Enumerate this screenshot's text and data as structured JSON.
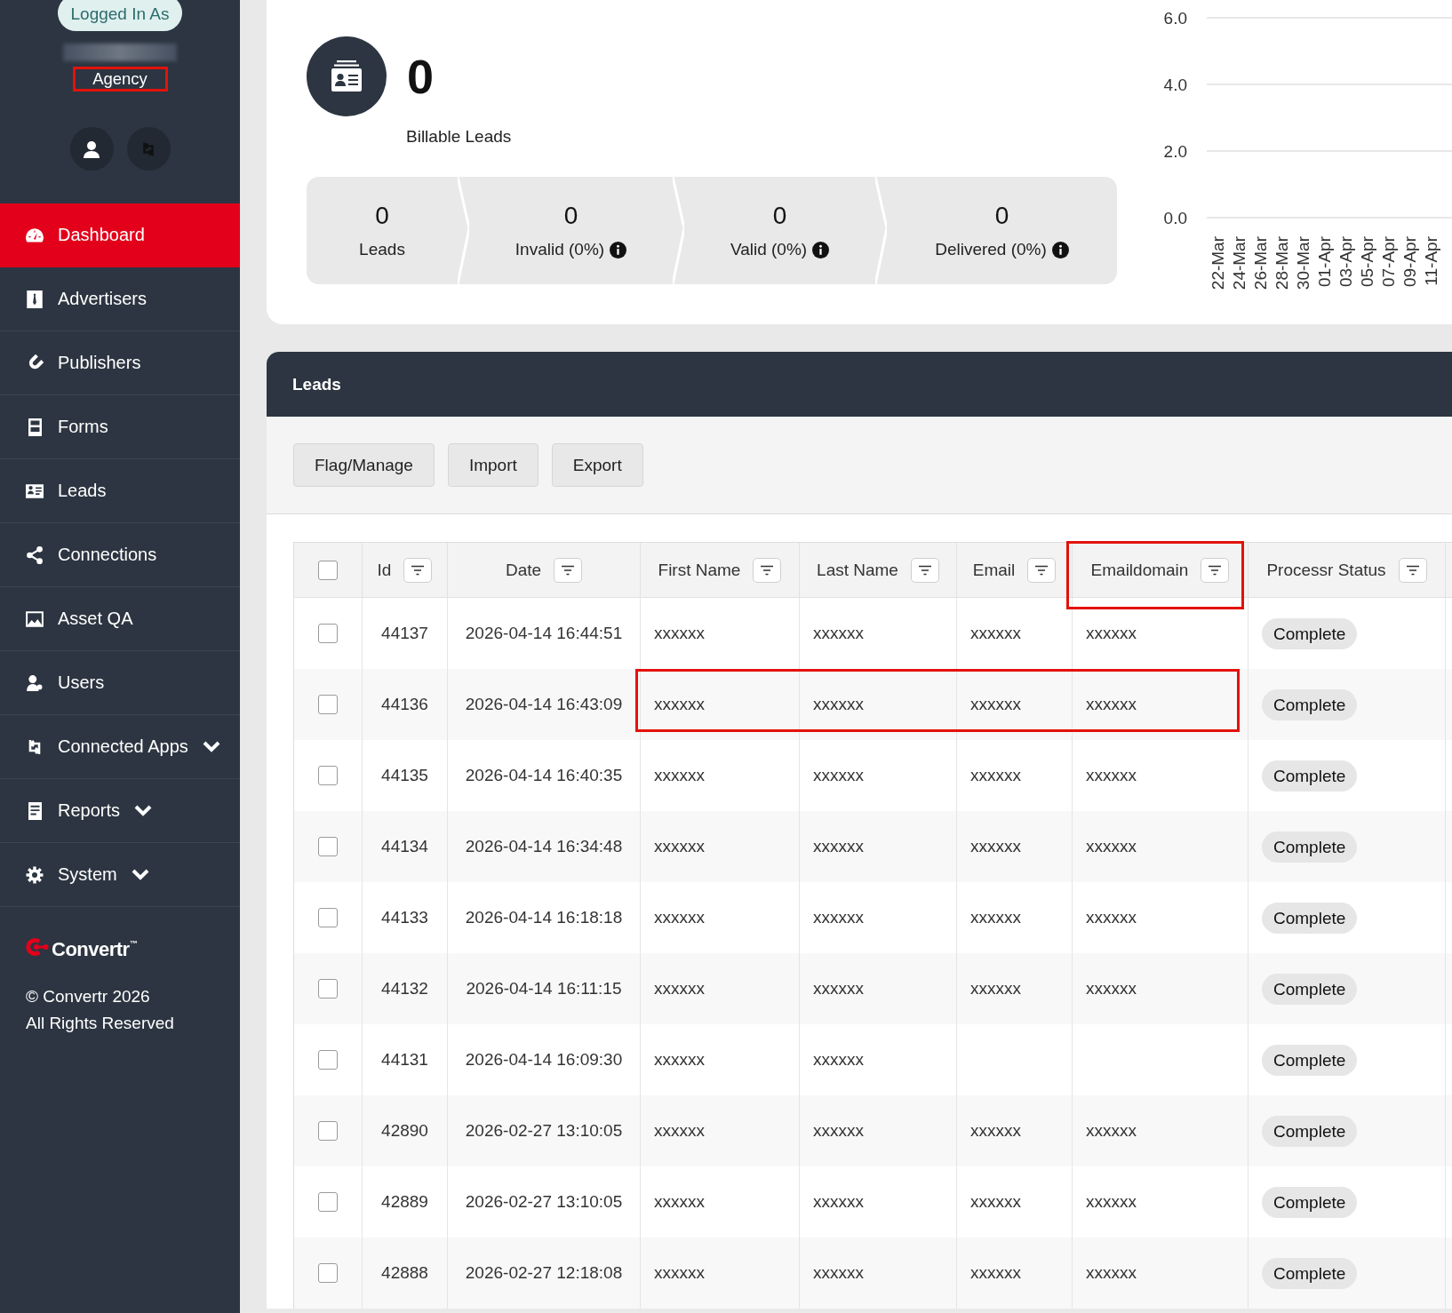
{
  "sidebar": {
    "account": {
      "badge": "Logged In As",
      "name_blurred": true,
      "role": "Agency",
      "role_highlighted": true
    },
    "nav": [
      {
        "label": "Dashboard",
        "kind": "link",
        "selected": true
      },
      {
        "label": "Advertisers",
        "kind": "link",
        "selected": false
      },
      {
        "label": "Publishers",
        "kind": "link",
        "selected": false
      },
      {
        "label": "Forms",
        "kind": "link",
        "selected": false
      },
      {
        "label": "Leads",
        "kind": "link",
        "selected": false
      },
      {
        "label": "Connections",
        "kind": "link",
        "selected": false
      },
      {
        "label": "Asset QA",
        "kind": "link",
        "selected": false
      },
      {
        "label": "Users",
        "kind": "link",
        "selected": false
      },
      {
        "label": "Connected Apps",
        "kind": "group",
        "selected": false
      },
      {
        "label": "Reports",
        "kind": "group",
        "selected": false
      },
      {
        "label": "System",
        "kind": "group",
        "selected": false
      }
    ],
    "brand": "Convertr$^{™}$",
    "footer": [
      "© Convertr 2026",
      "All Rights Reserved"
    ]
  },
  "leads_breakdown": {
    "billable_leads": {
      "value": "0",
      "label": "Billable Leads"
    },
    "funnel": [
      {
        "value": "0",
        "label": "Leads",
        "info": false
      },
      {
        "value": "0",
        "label": "Invalid (0%)",
        "info": true
      },
      {
        "value": "0",
        "label": "Valid (0%)",
        "info": true
      },
      {
        "value": "0",
        "label": "Delivered (0%)",
        "info": true
      }
    ],
    "chart_data": {
      "type": "line",
      "categories": [
        "22-Mar",
        "24-Mar",
        "26-Mar",
        "28-Mar",
        "30-Mar",
        "01-Apr",
        "03-Apr",
        "05-Apr",
        "07-Apr",
        "09-Apr",
        "11-Apr"
      ],
      "ylim": [
        0,
        6
      ],
      "yticks": [
        {
          "value": 0,
          "label": "0.0"
        },
        {
          "value": 2,
          "label": "2.0"
        },
        {
          "value": 4,
          "label": "4.0"
        },
        {
          "value": 6,
          "label": "6.0"
        }
      ]
    }
  },
  "leads_panel": {
    "title": "Leads",
    "actions": [
      "Flag/Manage",
      "Import",
      "Export"
    ],
    "table": {
      "select_all_checked": false,
      "columns": [
        {
          "label": "Id",
          "highlighted": false
        },
        {
          "label": "Date",
          "highlighted": false
        },
        {
          "label": "First Name",
          "highlighted": false
        },
        {
          "label": "Last Name",
          "highlighted": false
        },
        {
          "label": "Email",
          "highlighted": false
        },
        {
          "label": "Emaildomain",
          "highlighted": true
        },
        {
          "label": "Processr Status",
          "highlighted": false
        }
      ],
      "rows": [
        {
          "id": "44137",
          "date": "2026-04-14 16:44:51",
          "first_name": "xxxxxx",
          "last_name": "xxxxxx",
          "email": "xxxxxx",
          "emaildomain": "xxxxxx",
          "processr_status": "Complete",
          "checked": false,
          "highlighted": false
        },
        {
          "id": "44136",
          "date": "2026-04-14 16:43:09",
          "first_name": "xxxxxx",
          "last_name": "xxxxxx",
          "email": "xxxxxx",
          "emaildomain": "xxxxxx",
          "processr_status": "Complete",
          "checked": false,
          "highlighted": true
        },
        {
          "id": "44135",
          "date": "2026-04-14 16:40:35",
          "first_name": "xxxxxx",
          "last_name": "xxxxxx",
          "email": "xxxxxx",
          "emaildomain": "xxxxxx",
          "processr_status": "Complete",
          "checked": false,
          "highlighted": false
        },
        {
          "id": "44134",
          "date": "2026-04-14 16:34:48",
          "first_name": "xxxxxx",
          "last_name": "xxxxxx",
          "email": "xxxxxx",
          "emaildomain": "xxxxxx",
          "processr_status": "Complete",
          "checked": false,
          "highlighted": false
        },
        {
          "id": "44133",
          "date": "2026-04-14 16:18:18",
          "first_name": "xxxxxx",
          "last_name": "xxxxxx",
          "email": "xxxxxx",
          "emaildomain": "xxxxxx",
          "processr_status": "Complete",
          "checked": false,
          "highlighted": false
        },
        {
          "id": "44132",
          "date": "2026-04-14 16:11:15",
          "first_name": "xxxxxx",
          "last_name": "xxxxxx",
          "email": "xxxxxx",
          "emaildomain": "xxxxxx",
          "processr_status": "Complete",
          "checked": false,
          "highlighted": false
        },
        {
          "id": "44131",
          "date": "2026-04-14 16:09:30",
          "first_name": "xxxxxx",
          "last_name": "xxxxxx",
          "processr_status": "Complete",
          "checked": false,
          "highlighted": false
        },
        {
          "id": "42890",
          "date": "2026-02-27 13:10:05",
          "first_name": "xxxxxx",
          "last_name": "xxxxxx",
          "email": "xxxxxx",
          "emaildomain": "xxxxxx",
          "processr_status": "Complete",
          "checked": false,
          "highlighted": false
        },
        {
          "id": "42889",
          "date": "2026-02-27 13:10:05",
          "first_name": "xxxxxx",
          "last_name": "xxxxxx",
          "email": "xxxxxx",
          "emaildomain": "xxxxxx",
          "processr_status": "Complete",
          "checked": false,
          "highlighted": false
        },
        {
          "id": "42888",
          "date": "2026-02-27 12:18:08",
          "first_name": "xxxxxx",
          "last_name": "xxxxxx",
          "email": "xxxxxx",
          "emaildomain": "xxxxxx",
          "processr_status": "Complete",
          "checked": false,
          "highlighted": false
        }
      ]
    }
  }
}
